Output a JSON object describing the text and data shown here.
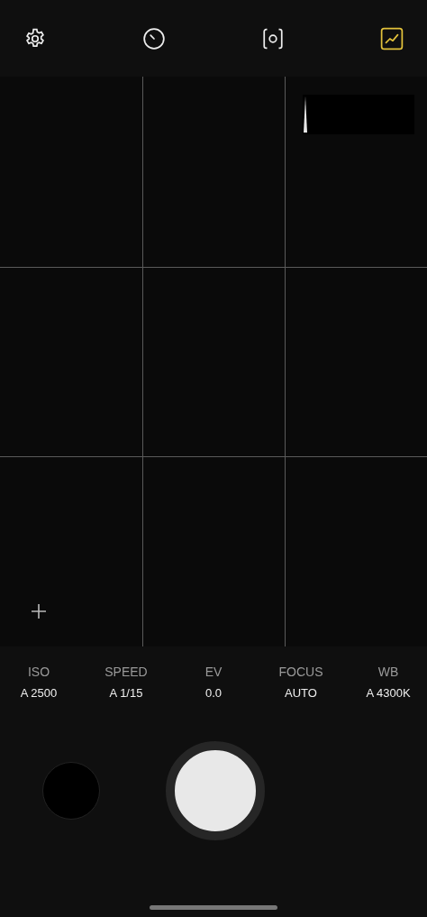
{
  "toolbar": [
    {
      "kind": "settings",
      "selected": false
    },
    {
      "kind": "timer",
      "selected": false
    },
    {
      "kind": "lens",
      "selected": false
    },
    {
      "kind": "histogram",
      "selected": true
    }
  ],
  "settings": [
    {
      "label": "ISO",
      "value": "A 2500"
    },
    {
      "label": "SPEED",
      "value": "A 1/15"
    },
    {
      "label": "EV",
      "value": "0.0"
    },
    {
      "label": "FOCUS",
      "value": "AUTO"
    },
    {
      "label": "WB",
      "value": "A 4300K"
    }
  ]
}
